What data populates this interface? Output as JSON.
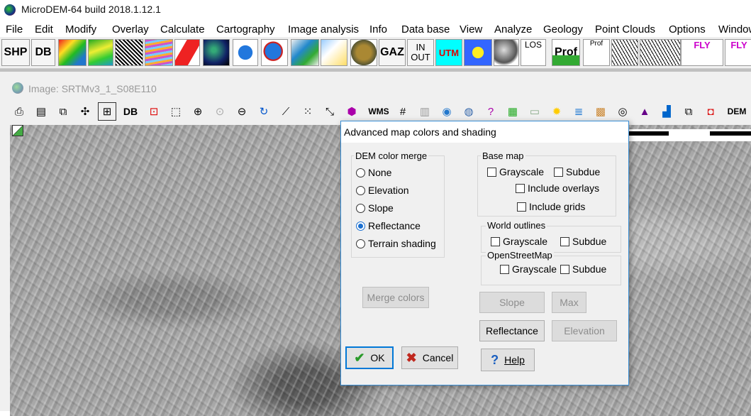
{
  "app": {
    "title": "MicroDEM-64 build 2018.1.12.1"
  },
  "menu": [
    "File",
    "Edit",
    "Modify",
    "Overlay",
    "Calculate",
    "Cartography",
    "Image analysis",
    "Info",
    "Data base",
    "View",
    "Analyze",
    "Geology",
    "Point Clouds",
    "Options",
    "Window"
  ],
  "toolbar": {
    "shp_label": "SHP",
    "db_label": "DB",
    "gaz_label": "GAZ",
    "inout_top": "IN",
    "inout_bottom": "OUT",
    "utm_label": "UTM",
    "los_label": "LOS",
    "prof_label": "Prof",
    "prof_small_label": "Prof",
    "fly_label": "FLY",
    "fly_label2": "FLY"
  },
  "image_window": {
    "title": "Image: SRTMv3_1_S08E110",
    "tools": {
      "db_label": "DB",
      "wms_label": "WMS",
      "dem_label": "DEM"
    }
  },
  "dialog": {
    "title": "Advanced  map colors and shading",
    "dem_color_merge": {
      "label": "DEM color merge",
      "options": [
        "None",
        "Elevation",
        "Slope",
        "Reflectance",
        "Terrain shading"
      ],
      "selected": "Reflectance"
    },
    "base_map": {
      "label": "Base map",
      "grayscale": "Grayscale",
      "subdue": "Subdue",
      "include_overlays": "Include overlays",
      "include_grids": "Include grids"
    },
    "world_outlines": {
      "label": "World outlines",
      "grayscale": "Grayscale",
      "subdue": "Subdue"
    },
    "openstreetmap": {
      "label": "OpenStreetMap",
      "grayscale": "Grayscale",
      "subdue": "Subdue"
    },
    "buttons": {
      "merge_colors": "Merge colors",
      "slope": "Slope",
      "max": "Max",
      "reflectance": "Reflectance",
      "elevation": "Elevation",
      "ok": "OK",
      "cancel": "Cancel",
      "help": "Help"
    }
  }
}
